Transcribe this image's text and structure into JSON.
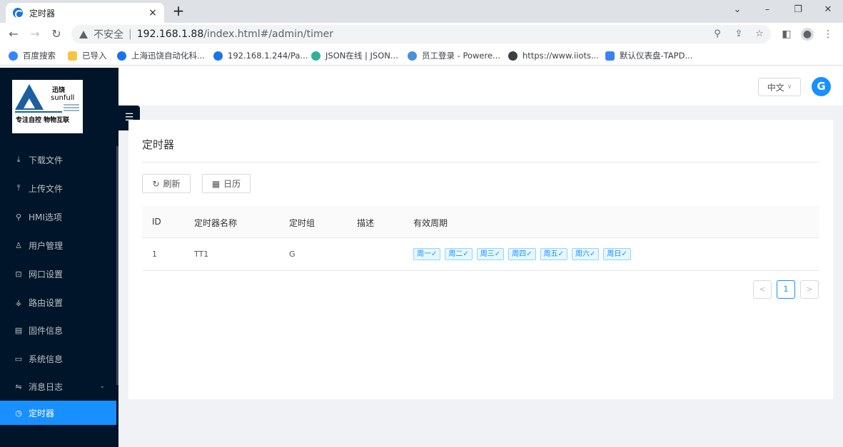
{
  "browser": {
    "tab_title": "定时器",
    "tab_close": "×",
    "new_tab": "+",
    "window_controls": {
      "minimize": "–",
      "restore": "❐",
      "close": "✕",
      "dropdown": "⌄"
    },
    "insecure_label": "不安全",
    "separator": "|",
    "url_host": "192.168.1.88",
    "url_path": "/index.html#/admin/timer",
    "bookmarks": [
      {
        "label": "百度搜索",
        "color": "#3385ff"
      },
      {
        "label": "已导入",
        "color": "#f5c542"
      },
      {
        "label": "上海迅饶自动化科...",
        "color": "#1a73e8"
      },
      {
        "label": "192.168.1.244/Pa...",
        "color": "#1a73e8"
      },
      {
        "label": "JSON在线 | JSON...",
        "color": "#2eb398"
      },
      {
        "label": "员工登录 - Powere...",
        "color": "#4a90d9"
      },
      {
        "label": "https://www.iiots...",
        "color": "#3c4043"
      },
      {
        "label": "默认仪表盘-TAPD...",
        "color": "#3b82f6"
      }
    ]
  },
  "logo": {
    "cn": "迅饶",
    "en": "sunfull",
    "slogan": "专注自控 物物互联"
  },
  "sidebar": {
    "items": [
      {
        "label": "下载文件",
        "icon": "⤓"
      },
      {
        "label": "上传文件",
        "icon": "⤒"
      },
      {
        "label": "HMI选项",
        "icon": "⚲"
      },
      {
        "label": "用户管理",
        "icon": "♙"
      },
      {
        "label": "网口设置",
        "icon": "⊡"
      },
      {
        "label": "路由设置",
        "icon": "⚶"
      },
      {
        "label": "固件信息",
        "icon": "▤"
      },
      {
        "label": "系统信息",
        "icon": "▭"
      },
      {
        "label": "消息日志",
        "icon": "⇋",
        "chevron": "⌄"
      },
      {
        "label": "定时器",
        "icon": "◷"
      }
    ],
    "collapse_icon": "☰"
  },
  "topbar": {
    "language": "中文",
    "language_arrow": "∨",
    "avatar_glyph": "G"
  },
  "page": {
    "title": "定时器",
    "refresh_label": "刷新",
    "refresh_icon": "↻",
    "calendar_label": "日历",
    "calendar_icon": "▦"
  },
  "table": {
    "headers": [
      "ID",
      "定时器名称",
      "定时组",
      "描述",
      "有效周期"
    ],
    "rows": [
      {
        "id": "1",
        "name": "TT1",
        "group": "G",
        "desc": "",
        "days": [
          "周一✓",
          "周二✓",
          "周三✓",
          "周四✓",
          "周五✓",
          "周六✓",
          "周日✓"
        ]
      }
    ]
  },
  "pagination": {
    "prev": "<",
    "current": "1",
    "next": ">"
  },
  "colors": {
    "sidebar": "#001529",
    "accent": "#1890ff",
    "content_bg": "#f0f2f5"
  }
}
